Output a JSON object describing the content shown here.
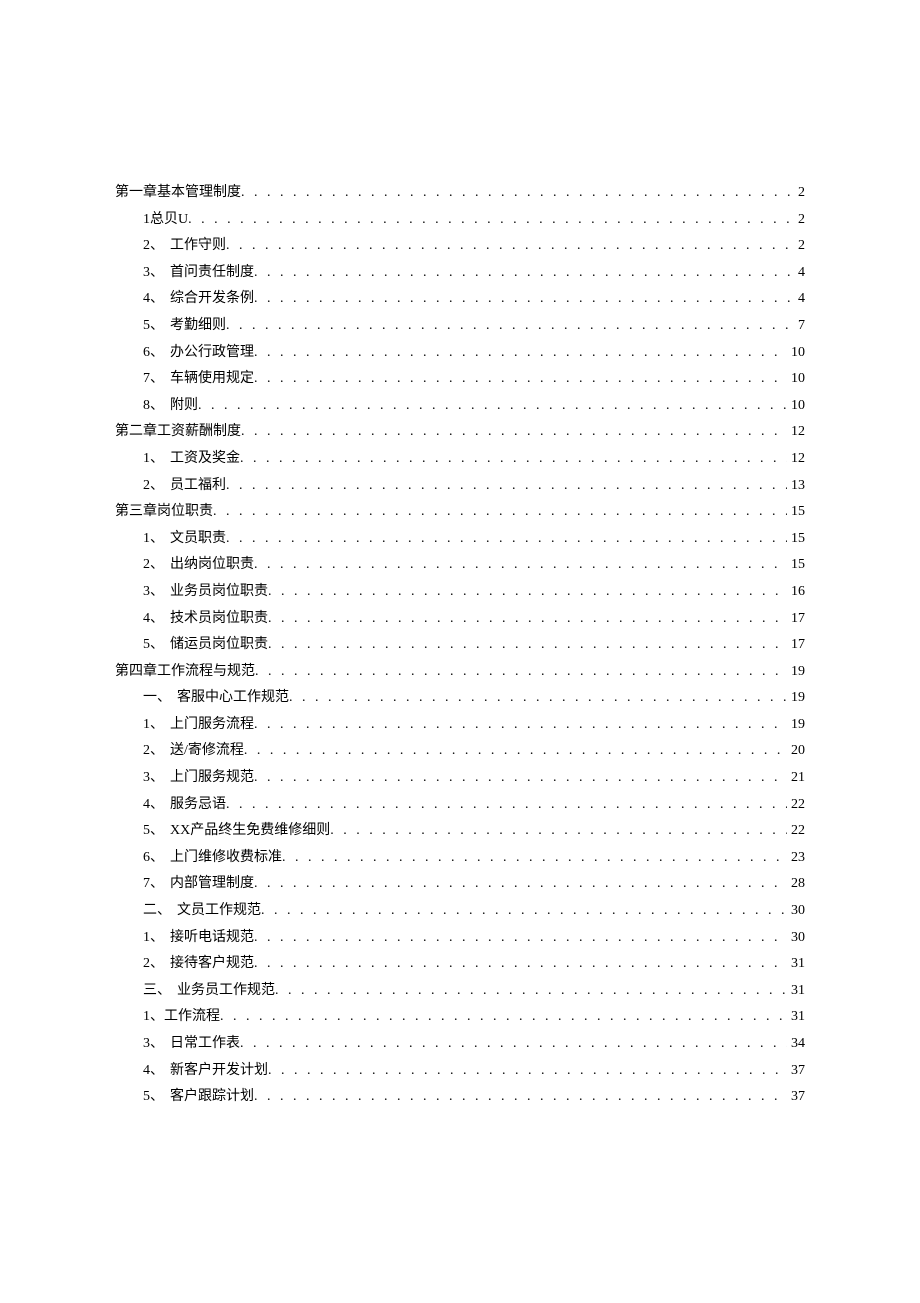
{
  "toc": [
    {
      "indent": 0,
      "prefix": "",
      "label": "第一章基本管理制度",
      "page": "2",
      "padClass": ""
    },
    {
      "indent": 1,
      "prefix": "",
      "label": "1总贝U",
      "page": "2",
      "padClass": ""
    },
    {
      "indent": 2,
      "prefix": "2、",
      "label": "工作守则",
      "page": "2",
      "padClass": ""
    },
    {
      "indent": 2,
      "prefix": "3、",
      "label": "首问责任制度",
      "page": "4",
      "padClass": "pad-560"
    },
    {
      "indent": 2,
      "prefix": "4、",
      "label": "综合开发条例",
      "page": "4",
      "padClass": "pad-560"
    },
    {
      "indent": 2,
      "prefix": "5、",
      "label": "考勤细则",
      "page": "7",
      "padClass": "pad-560"
    },
    {
      "indent": 2,
      "prefix": "6、",
      "label": "办公行政管理",
      "page": "10",
      "padClass": ""
    },
    {
      "indent": 2,
      "prefix": "7、",
      "label": "车辆使用规定",
      "page": "10",
      "padClass": ""
    },
    {
      "indent": 2,
      "prefix": "8、",
      "label": "附则",
      "page": "10",
      "padClass": ""
    },
    {
      "indent": 0,
      "prefix": "",
      "label": "第二章工资薪酬制度",
      "page": "12",
      "padClass": ""
    },
    {
      "indent": 2,
      "prefix": "1、",
      "label": "工资及奖金",
      "page": "12",
      "padClass": "pad-560"
    },
    {
      "indent": 2,
      "prefix": "2、",
      "label": "员工福利",
      "page": "13",
      "padClass": ""
    },
    {
      "indent": 0,
      "prefix": "",
      "label": "第三章岗位职责",
      "page": "15",
      "padClass": ""
    },
    {
      "indent": 2,
      "prefix": "1、",
      "label": "文员职责",
      "page": "15",
      "padClass": ""
    },
    {
      "indent": 2,
      "prefix": "2、",
      "label": "出纳岗位职责",
      "page": "15",
      "padClass": ""
    },
    {
      "indent": 2,
      "prefix": "3、",
      "label": "业务员岗位职责",
      "page": "16",
      "padClass": ""
    },
    {
      "indent": 2,
      "prefix": "4、",
      "label": "技术员岗位职责",
      "page": "17",
      "padClass": ""
    },
    {
      "indent": 2,
      "prefix": "5、",
      "label": "储运员岗位职责",
      "page": "17",
      "padClass": ""
    },
    {
      "indent": 0,
      "prefix": "",
      "label": "第四章工作流程与规范",
      "page": "19",
      "padClass": ""
    },
    {
      "indent": 2,
      "prefix": "一、",
      "label": "客服中心工作规范",
      "page": "19",
      "padClass": ""
    },
    {
      "indent": 2,
      "prefix": "1、",
      "label": "上门服务流程",
      "page": "19",
      "padClass": ""
    },
    {
      "indent": 2,
      "prefix": "2、",
      "label": "送/寄修流程",
      "page": "20",
      "padClass": "pad-560"
    },
    {
      "indent": 2,
      "prefix": "3、",
      "label": "上门服务规范",
      "page": "21",
      "padClass": "pad-560"
    },
    {
      "indent": 2,
      "prefix": "4、",
      "label": "服务忌语",
      "page": "22",
      "padClass": ""
    },
    {
      "indent": 2,
      "prefix": "5、",
      "label": "XX产品终生免费维修细则",
      "page": "22",
      "padClass": ""
    },
    {
      "indent": 2,
      "prefix": "6、",
      "label": "上门维修收费标准",
      "page": "23",
      "padClass": ""
    },
    {
      "indent": 2,
      "prefix": "7、",
      "label": "内部管理制度",
      "page": "28",
      "padClass": ""
    },
    {
      "indent": 2,
      "prefix": "二、",
      "label": "文员工作规范",
      "page": "30",
      "padClass": "pad-500"
    },
    {
      "indent": 2,
      "prefix": "1、",
      "label": "接听电话规范",
      "page": "30",
      "padClass": "pad-500"
    },
    {
      "indent": 2,
      "prefix": "2、",
      "label": "接待客户规范",
      "page": "31",
      "padClass": ""
    },
    {
      "indent": 2,
      "prefix": "三、",
      "label": "业务员工作规范",
      "page": "31",
      "padClass": ""
    },
    {
      "indent": 2,
      "prefix": "",
      "label": "1、工作流程",
      "page": "31",
      "padClass": ""
    },
    {
      "indent": 2,
      "prefix": "3、",
      "label": "日常工作表",
      "page": "34",
      "padClass": "pad-500"
    },
    {
      "indent": 2,
      "prefix": "4、",
      "label": "新客户开发计划",
      "page": "37",
      "padClass": "pad-500"
    },
    {
      "indent": 2,
      "prefix": "5、",
      "label": "客户跟踪计划",
      "page": "37",
      "padClass": "pad-500"
    }
  ]
}
